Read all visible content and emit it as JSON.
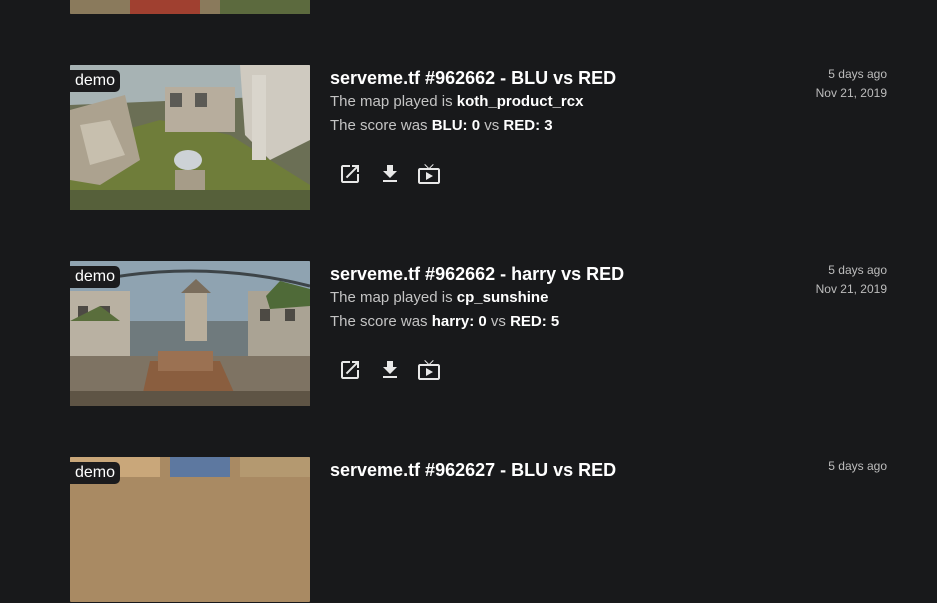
{
  "demos": [
    {
      "title": "serveme.tf #962662 - BLU vs RED",
      "map_prefix": "The map played is",
      "map": "koth_product_rcx",
      "score_prefix": "The score was",
      "team1_label": "BLU: 0",
      "vs": "vs",
      "team2_label": "RED: 3",
      "ago": "5 days ago",
      "date": "Nov 21, 2019",
      "badge": "demo"
    },
    {
      "title": "serveme.tf #962662 - harry vs RED",
      "map_prefix": "The map played is",
      "map": "cp_sunshine",
      "score_prefix": "The score was",
      "team1_label": "harry: 0",
      "vs": "vs",
      "team2_label": "RED: 5",
      "ago": "5 days ago",
      "date": "Nov 21, 2019",
      "badge": "demo"
    },
    {
      "title": "serveme.tf #962627 - BLU vs RED",
      "ago": "5 days ago",
      "badge": "demo"
    }
  ],
  "actions": {
    "open_icon": "open-in-new-icon",
    "download_icon": "download-icon",
    "view_icon": "view-demo-icon"
  },
  "colors": {
    "background": "#18191b",
    "text_primary": "#ffffff",
    "text_secondary": "#c4c4c4"
  }
}
